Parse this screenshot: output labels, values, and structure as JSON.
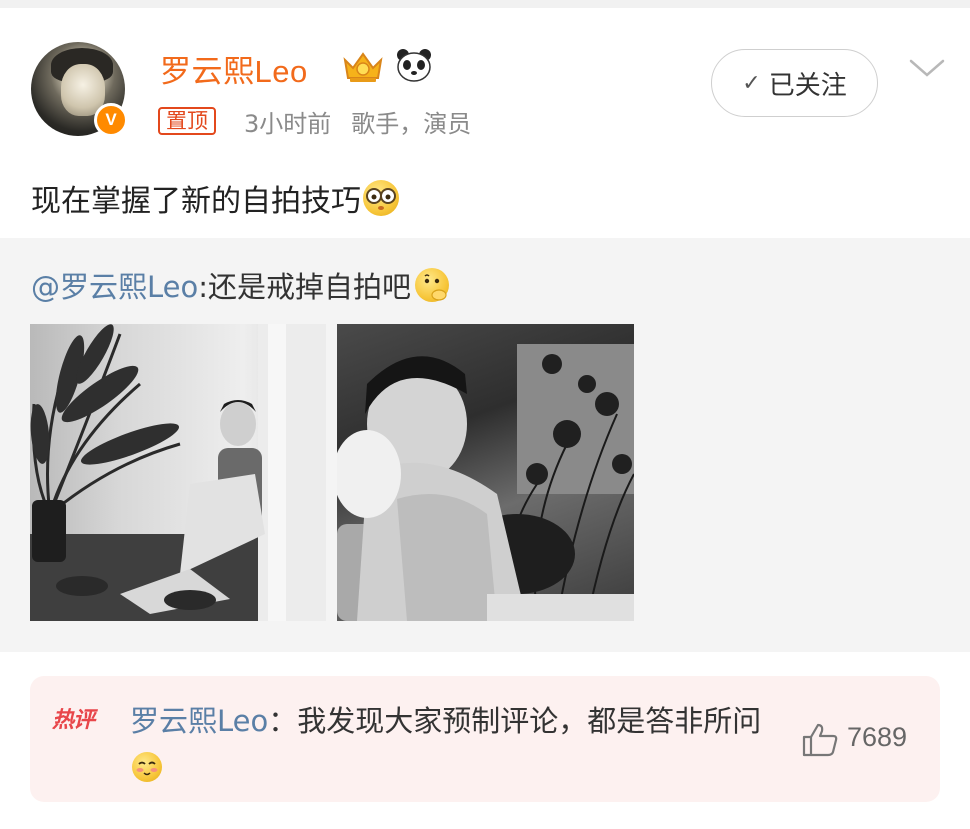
{
  "post": {
    "author": "罗云熙Leo",
    "verified_icon": "v-badge",
    "badges": [
      "crown-icon",
      "panda-icon"
    ],
    "pin_label": "置顶",
    "time": "3小时前",
    "bio": "歌手，演员",
    "follow_label": "已关注",
    "text": "现在掌握了新的自拍技巧",
    "text_emoji": "glasses-emoji"
  },
  "repost": {
    "mention": "@罗云熙Leo",
    "text": ":还是戒掉自拍吧",
    "text_emoji": "thinking-emoji",
    "photos": [
      "photo-1",
      "photo-2"
    ]
  },
  "hot_comment": {
    "label": "热评",
    "author": "罗云熙Leo",
    "text": "：我发现大家预制评论，都是答非所问",
    "text_emoji": "shy-emoji",
    "like_count": "7689"
  },
  "colors": {
    "username": "#f26a1b",
    "link": "#5a7fa6",
    "hot": "#e8464a",
    "card_bg": "#f4f4f4",
    "hot_bg": "#fdf1f0"
  }
}
